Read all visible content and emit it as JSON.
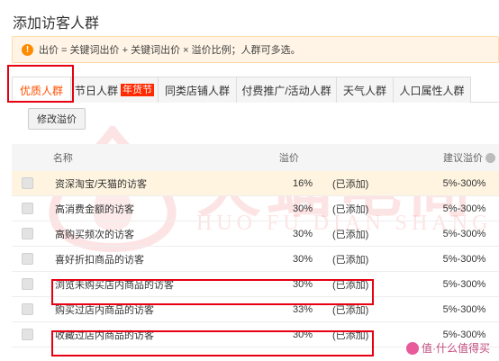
{
  "page": {
    "title": "添加访客人群"
  },
  "notice": {
    "text": "出价 = 关键词出价 + 关键词出价 × 溢价比例；人群可多选。",
    "icon": "warning-icon"
  },
  "tabs": [
    {
      "label": "优质人群",
      "active": true
    },
    {
      "label": "节日人群",
      "badge": "年货节"
    },
    {
      "label": "同类店铺人群"
    },
    {
      "label": "付费推广/活动人群"
    },
    {
      "label": "天气人群"
    },
    {
      "label": "人口属性人群"
    }
  ],
  "toolbar": {
    "modify_label": "修改溢价"
  },
  "table": {
    "headers": {
      "name": "名称",
      "bid": "溢价",
      "range": "建议溢价"
    },
    "rows": [
      {
        "name": "资深淘宝/天猫的访客",
        "bid": "16%",
        "status": "(已添加)",
        "range": "5%-300%"
      },
      {
        "name": "高消费金额的访客",
        "bid": "30%",
        "status": "(已添加)",
        "range": "5%-300%"
      },
      {
        "name": "高购买频次的访客",
        "bid": "30%",
        "status": "(已添加)",
        "range": "5%-300%"
      },
      {
        "name": "喜好折扣商品的访客",
        "bid": "30%",
        "status": "(已添加)",
        "range": "5%-300%"
      },
      {
        "name": "浏览未购买店内商品的访客",
        "bid": "30%",
        "status": "(已添加)",
        "range": "5%-300%"
      },
      {
        "name": "购买过店内商品的访客",
        "bid": "33%",
        "status": "(已添加)",
        "range": "5%-300%"
      },
      {
        "name": "收藏过店内商品的访客",
        "bid": "30%",
        "status": "(已添加)",
        "range": "5%-300%"
      }
    ]
  },
  "watermark": {
    "cn": "火蝠电商",
    "en": "HUO FU DIAN SHANG"
  },
  "corner": {
    "text": "值·什么值得买"
  },
  "colors": {
    "accent": "#ff5000",
    "highlight": "#e60012",
    "notice_bg": "#fff4e5"
  }
}
